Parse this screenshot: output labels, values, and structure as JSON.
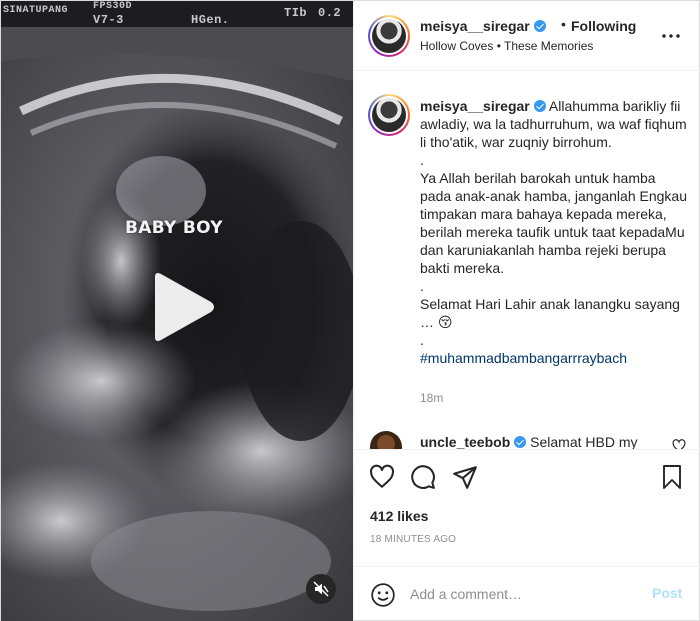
{
  "media": {
    "overlay_texts": [
      "SINATUPANG",
      "FPS30D",
      "V7-3",
      "HGen.",
      "TIb",
      "0.2"
    ],
    "baby_label": "BABY BOY"
  },
  "header": {
    "username": "meisya__siregar",
    "separator": "•",
    "follow_status": "Following",
    "music": "Hollow Coves • These Memories"
  },
  "caption": {
    "username": "meisya__siregar",
    "lines": [
      "Allahumma barikliy fii awladiy, wa la tadhurruhum, wa waf fiqhum li tho'atik, war zuqniy birrohum.",
      ".",
      "Ya Allah berilah barokah untuk hamba pada anak-anak hamba, janganlah Engkau timpakan mara bahaya kepada mereka, berilah mereka taufik untuk taat kepadaMu dan karuniakanlah hamba rejeki berupa bakti mereka.",
      ".",
      "Selamat Hari Lahir anak lanangku sayang … 😚",
      "."
    ],
    "hashtag": "#muhammadbambangarrraybach",
    "time": "18m"
  },
  "comment2": {
    "username": "uncle_teebob",
    "text": "Selamat HBD my"
  },
  "actions": {
    "likes": "412 likes",
    "time_ago": "18 MINUTES AGO",
    "comment_placeholder": "Add a comment…",
    "post_label": "Post"
  },
  "colors": {
    "verified": "#3897f0",
    "hashtag": "#00376b",
    "post_disabled": "#b2dffc",
    "muted_text": "#8e8e8e"
  }
}
